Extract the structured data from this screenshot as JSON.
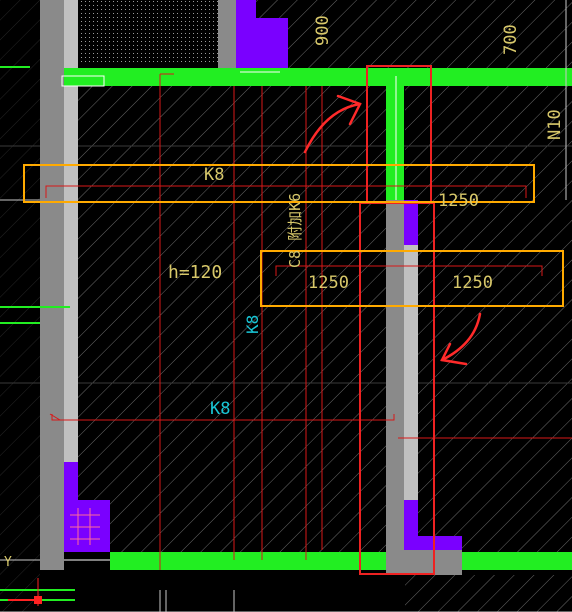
{
  "drawing": {
    "labels": {
      "dim_900": "900",
      "dim_700": "700",
      "code_n10": "N10",
      "rebar_k8_top": "K8",
      "dim_1250_top": "1250",
      "slab_thickness": "h=120",
      "additional_rebar": "C8 附加K6",
      "dim_1250_left": "1250",
      "dim_1250_right": "1250",
      "rebar_k8_vertical": "K8",
      "rebar_k8_bottom": "K8",
      "axis_y": "Y"
    },
    "colors": {
      "background": "#000000",
      "wall_green": "#22ee22",
      "column_purple": "#7a00ff",
      "wall_gray": "#8a8a8a",
      "rebar_red": "#d81818",
      "highlight_orange": "#ffaa00",
      "text_yellow": "#d8c86a",
      "text_cyan": "#19c6d6",
      "hatch": "#6a6a6a"
    }
  }
}
